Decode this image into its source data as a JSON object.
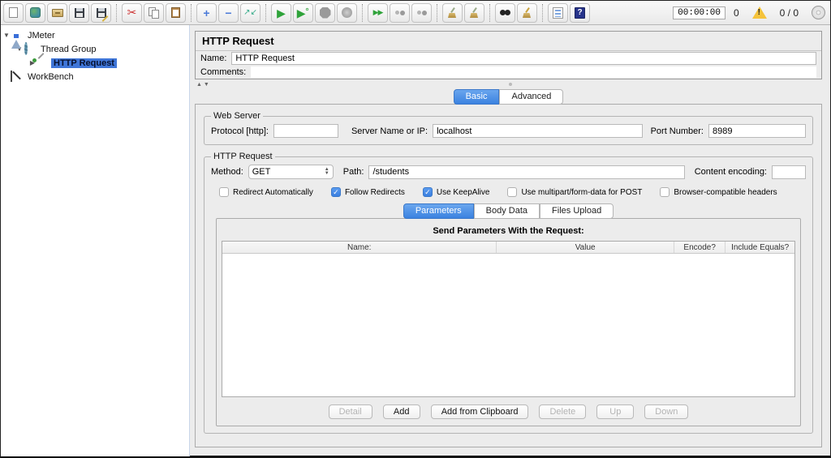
{
  "toolbar": {
    "icons": [
      "new-file",
      "templates",
      "open-file",
      "save",
      "save-as",
      "cut",
      "copy",
      "paste",
      "expand-all",
      "collapse-all",
      "toggle",
      "start",
      "start-no-pauses",
      "stop",
      "shutdown",
      "remote-start-all",
      "remote-stop-all",
      "remote-shutdown-all",
      "clear",
      "clear-all",
      "search",
      "search-reset",
      "function-helper",
      "help"
    ],
    "timer": "00:00:00",
    "error_count": "0",
    "thread_count": "0 / 0"
  },
  "tree": {
    "items": [
      {
        "label": "JMeter",
        "icon": "flask-icon",
        "expanded": true,
        "selected": false
      },
      {
        "label": "Thread Group",
        "icon": "gear-icon",
        "expanded": true,
        "selected": false
      },
      {
        "label": "HTTP Request",
        "icon": "dropper-icon",
        "expanded": false,
        "selected": true
      },
      {
        "label": "WorkBench",
        "icon": "workbench-icon",
        "expanded": false,
        "selected": false
      }
    ]
  },
  "main": {
    "title": "HTTP Request",
    "name_label": "Name:",
    "name_value": "HTTP Request",
    "comments_label": "Comments:",
    "comments_value": "",
    "tabs": [
      {
        "label": "Basic",
        "selected": true
      },
      {
        "label": "Advanced",
        "selected": false
      }
    ],
    "web_server": {
      "legend": "Web Server",
      "protocol_label": "Protocol [http]:",
      "protocol_value": "",
      "server_label": "Server Name or IP:",
      "server_value": "localhost",
      "port_label": "Port Number:",
      "port_value": "8989"
    },
    "http_request": {
      "legend": "HTTP Request",
      "method_label": "Method:",
      "method_value": "GET",
      "path_label": "Path:",
      "path_value": "/students",
      "encoding_label": "Content encoding:",
      "encoding_value": "",
      "checkboxes": [
        {
          "label": "Redirect Automatically",
          "checked": false
        },
        {
          "label": "Follow Redirects",
          "checked": true
        },
        {
          "label": "Use KeepAlive",
          "checked": true
        },
        {
          "label": "Use multipart/form-data for POST",
          "checked": false
        },
        {
          "label": "Browser-compatible headers",
          "checked": false
        }
      ],
      "param_tabs": [
        {
          "label": "Parameters",
          "selected": true
        },
        {
          "label": "Body Data",
          "selected": false
        },
        {
          "label": "Files Upload",
          "selected": false
        }
      ],
      "params": {
        "title": "Send Parameters With the Request:",
        "columns": [
          "Name:",
          "Value",
          "Encode?",
          "Include Equals?"
        ],
        "rows": []
      },
      "buttons": [
        {
          "label": "Detail",
          "enabled": false
        },
        {
          "label": "Add",
          "enabled": true
        },
        {
          "label": "Add from Clipboard",
          "enabled": true
        },
        {
          "label": "Delete",
          "enabled": false
        },
        {
          "label": "Up",
          "enabled": false
        },
        {
          "label": "Down",
          "enabled": false
        }
      ]
    }
  },
  "colors": {
    "selection_blue": "#3f76d8",
    "tab_blue": "#3b82e0",
    "checkbox_blue": "#3a7fe0",
    "warning_yellow": "#f5c33b",
    "panel_gray": "#ececec"
  }
}
